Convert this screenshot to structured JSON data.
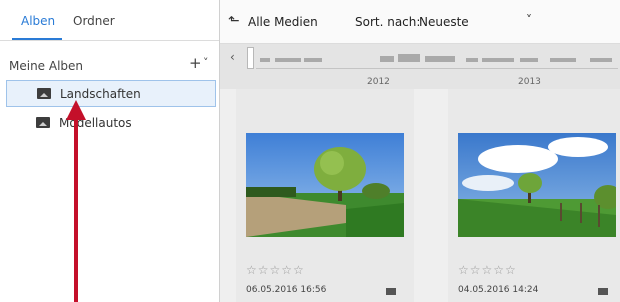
{
  "sidebar": {
    "tabs": [
      {
        "label": "Alben"
      },
      {
        "label": "Ordner"
      }
    ],
    "section_title": "Meine Alben",
    "add_symbol": "+",
    "collapse_symbol": "˅",
    "albums": [
      {
        "label": "Landschaften",
        "selected": true
      },
      {
        "label": "Modellautos",
        "selected": false
      }
    ]
  },
  "toolbar": {
    "back_symbol": "⬑",
    "all_media_label": "Alle Medien",
    "sort_label": "Sort. nach:",
    "sort_value": "Neueste",
    "dropdown_symbol": "˅"
  },
  "timeline": {
    "nav_left": "‹",
    "years": [
      "2012",
      "2013"
    ]
  },
  "photos": [
    {
      "rating_display": "☆☆☆☆☆",
      "date": "06.05.2016 16:56",
      "stars": 0
    },
    {
      "rating_display": "☆☆☆☆☆",
      "date": "04.05.2016 14:24",
      "stars": 0
    }
  ],
  "colors": {
    "accent": "#2a7bd6",
    "annotation_arrow": "#c4102a",
    "selected_bg": "#e8f1fb"
  }
}
